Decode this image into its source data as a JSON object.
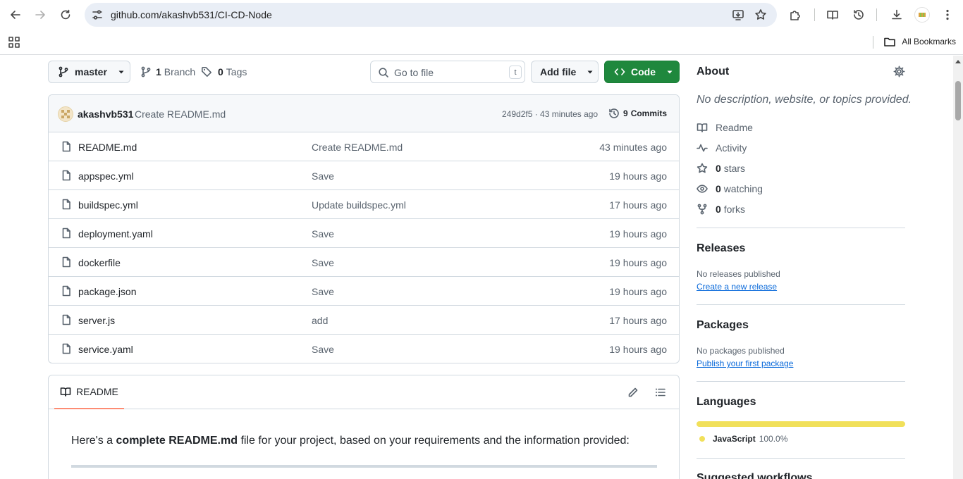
{
  "browser": {
    "url": "github.com/akashvb531/CI-CD-Node",
    "all_bookmarks": "All Bookmarks"
  },
  "toolbar": {
    "branch": "master",
    "branches_count": "1",
    "branches_label": "Branch",
    "tags_count": "0",
    "tags_label": "Tags",
    "go_to_file_placeholder": "Go to file",
    "go_to_file_shortcut": "t",
    "add_file": "Add file",
    "code": "Code"
  },
  "commit": {
    "author": "akashvb531",
    "message": "Create README.md",
    "meta": "249d2f5 · 43 minutes ago",
    "commits_count": "9",
    "commits_label": "Commits"
  },
  "files": [
    {
      "name": "README.md",
      "message": "Create README.md",
      "time": "43 minutes ago"
    },
    {
      "name": "appspec.yml",
      "message": "Save",
      "time": "19 hours ago"
    },
    {
      "name": "buildspec.yml",
      "message": "Update buildspec.yml",
      "time": "17 hours ago"
    },
    {
      "name": "deployment.yaml",
      "message": "Save",
      "time": "19 hours ago"
    },
    {
      "name": "dockerfile",
      "message": "Save",
      "time": "19 hours ago"
    },
    {
      "name": "package.json",
      "message": "Save",
      "time": "19 hours ago"
    },
    {
      "name": "server.js",
      "message": "add",
      "time": "17 hours ago"
    },
    {
      "name": "service.yaml",
      "message": "Save",
      "time": "19 hours ago"
    }
  ],
  "readme": {
    "tab_label": "README",
    "intro_before": "Here's a ",
    "intro_bold": "complete README.md",
    "intro_after": " file for your project, based on your requirements and the information provided:"
  },
  "about": {
    "title": "About",
    "description": "No description, website, or topics provided.",
    "readme_label": "Readme",
    "activity_label": "Activity",
    "stars_count": "0",
    "stars_label": "stars",
    "watching_count": "0",
    "watching_label": "watching",
    "forks_count": "0",
    "forks_label": "forks"
  },
  "releases": {
    "title": "Releases",
    "empty": "No releases published",
    "link": "Create a new release"
  },
  "packages": {
    "title": "Packages",
    "empty": "No packages published",
    "link": "Publish your first package"
  },
  "languages": {
    "title": "Languages",
    "items": [
      {
        "name": "JavaScript",
        "percent": "100.0%",
        "fraction": 1.0,
        "color": "#f1e05a"
      }
    ]
  },
  "suggested": {
    "title": "Suggested workflows"
  },
  "colors": {
    "code_button": "#1f883d",
    "link": "#0969da",
    "tab_underline": "#fd8c73"
  }
}
